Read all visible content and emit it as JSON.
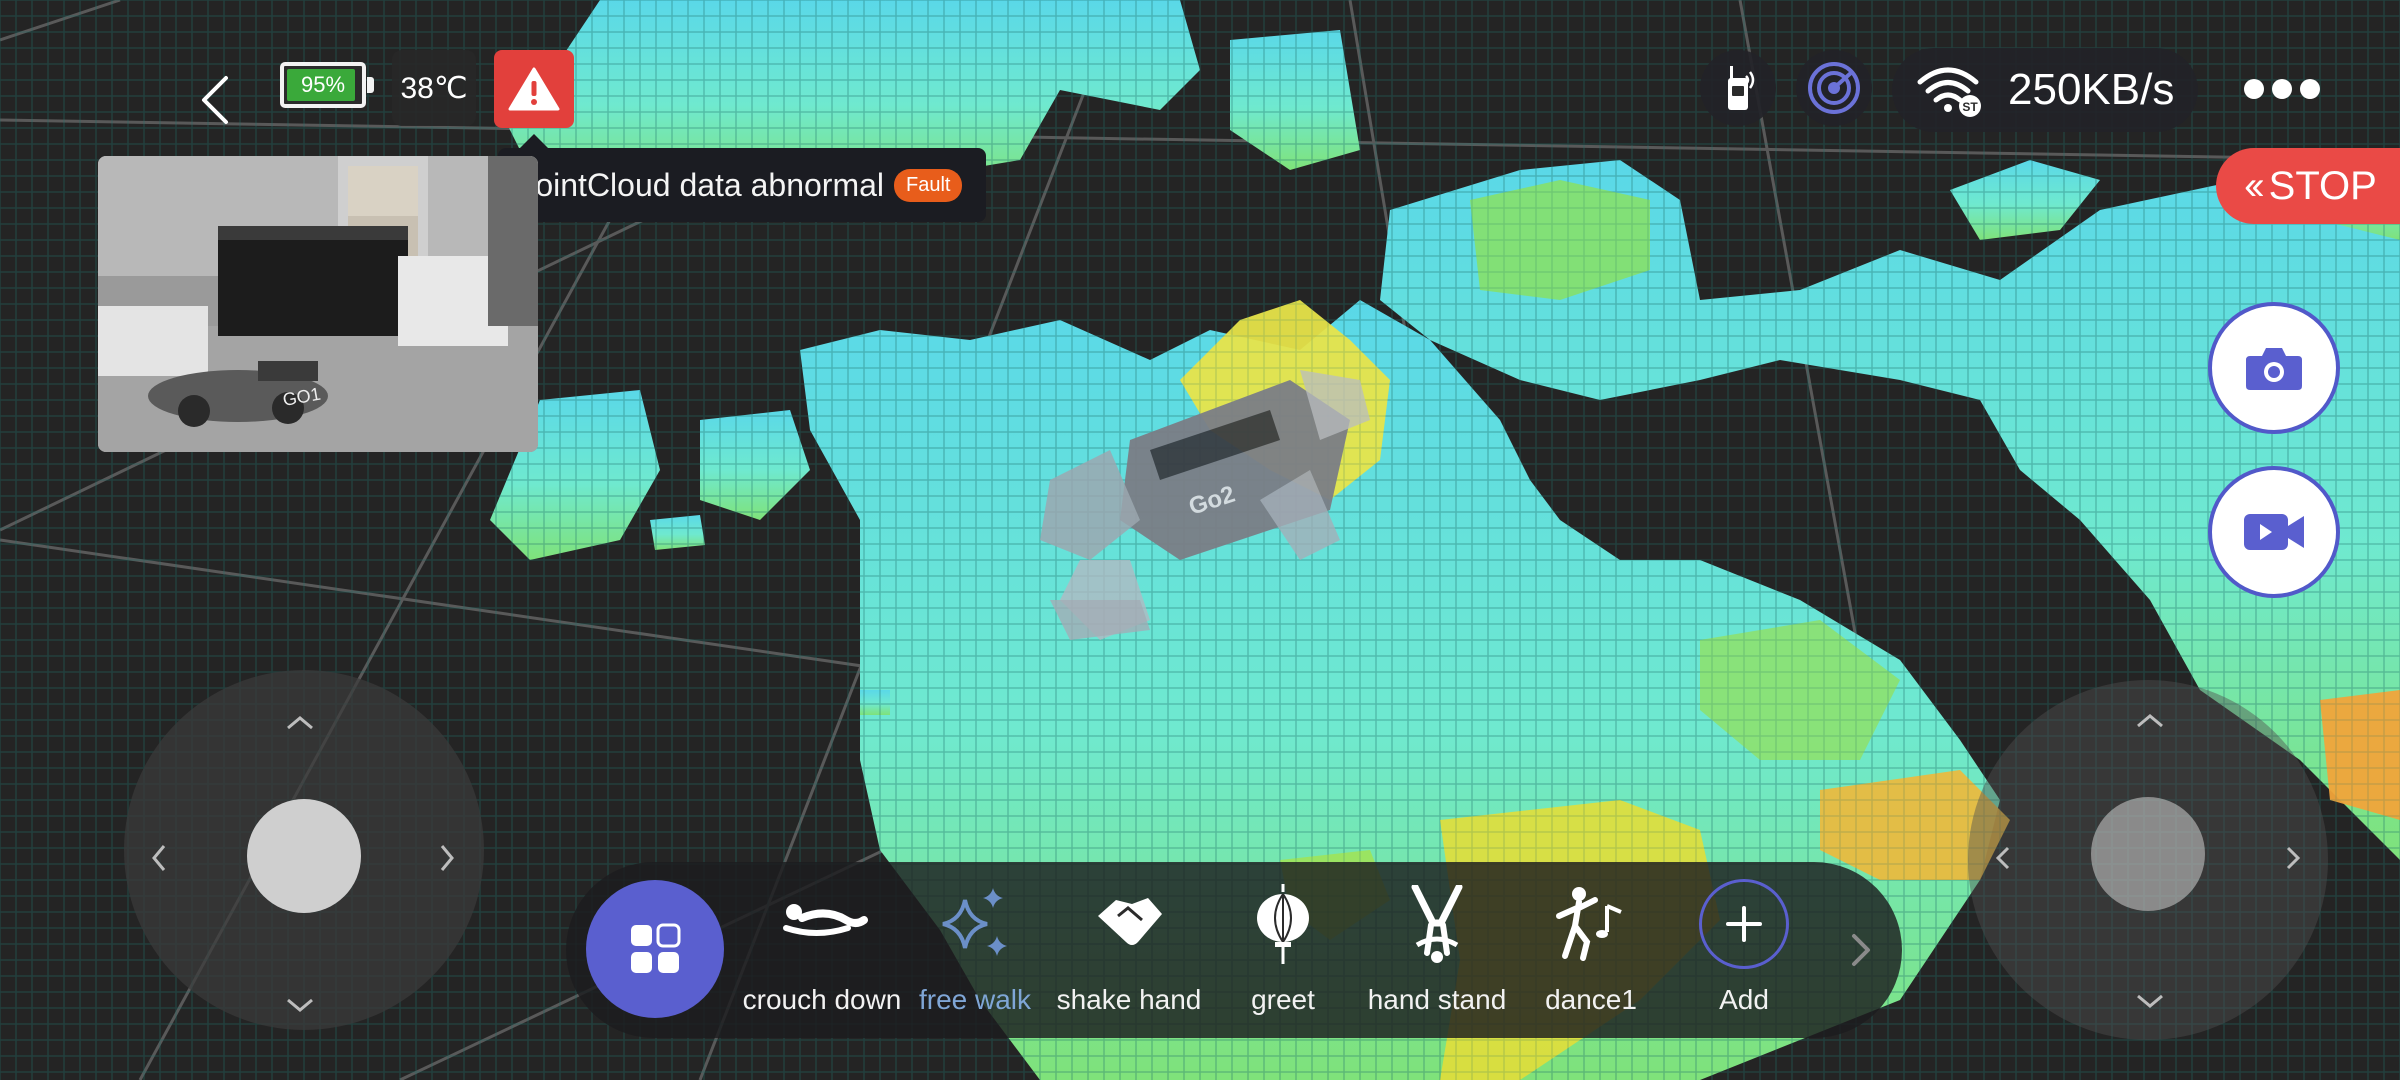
{
  "status": {
    "battery_percent": "95%",
    "battery_level": 0.95,
    "temperature": "38℃",
    "alert": {
      "message": "PointCloud data abnormal",
      "badge": "Fault"
    }
  },
  "map": {
    "robot_label": "Go2",
    "camera_preview_label": "GO1"
  },
  "network": {
    "speed": "250KB/s",
    "badge": "ST"
  },
  "controls": {
    "stop_label": "STOP"
  },
  "actions": [
    {
      "label": "crouch down",
      "icon": "crouch-icon"
    },
    {
      "label": "free walk",
      "icon": "sparkle-icon",
      "active": true
    },
    {
      "label": "shake hand",
      "icon": "handshake-icon"
    },
    {
      "label": "greet",
      "icon": "lantern-icon"
    },
    {
      "label": "hand stand",
      "icon": "handstand-icon"
    },
    {
      "label": "dance1",
      "icon": "dance-icon"
    },
    {
      "label": "Add",
      "icon": "plus-icon"
    }
  ],
  "colors": {
    "accent": "#5a5fcf",
    "stop": "#ea4a46",
    "warning": "#e2403c",
    "fault_badge": "#e85d1b",
    "battery_fill": "#3aa93a",
    "voxel_cyan": "#62e8d2",
    "voxel_yellow": "#e6e23a"
  }
}
